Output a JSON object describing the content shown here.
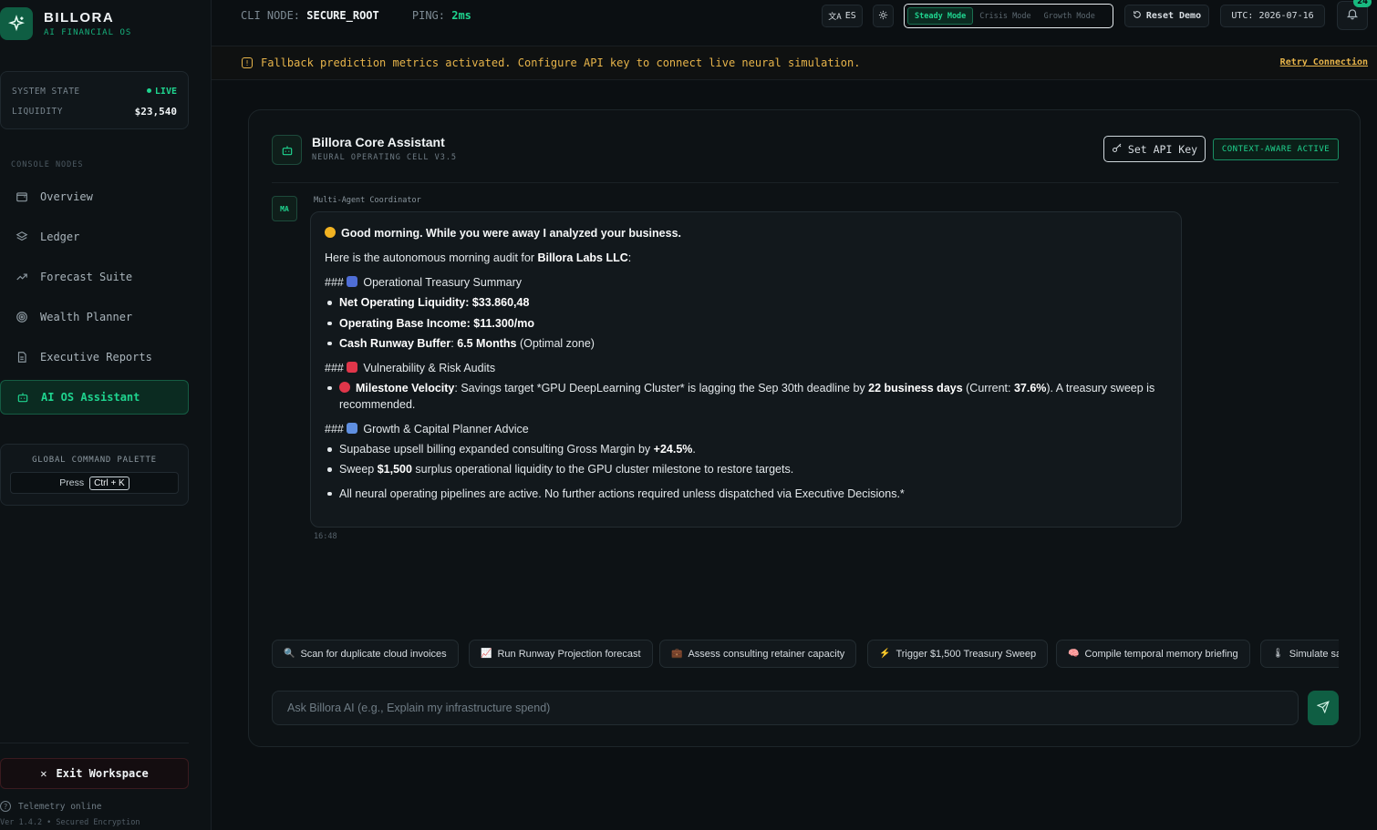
{
  "brand": {
    "name": "BILLORA",
    "subtitle": "AI FINANCIAL OS"
  },
  "system": {
    "state_label": "SYSTEM STATE",
    "state_value": "LIVE",
    "liquidity_label": "LIQUIDITY",
    "liquidity_value": "$23,540"
  },
  "nav": {
    "header": "CONSOLE NODES",
    "items": [
      {
        "label": "Overview",
        "icon": "wallet-icon"
      },
      {
        "label": "Ledger",
        "icon": "layers-icon"
      },
      {
        "label": "Forecast Suite",
        "icon": "trend-up-icon"
      },
      {
        "label": "Wealth Planner",
        "icon": "target-icon"
      },
      {
        "label": "Executive Reports",
        "icon": "document-icon"
      },
      {
        "label": "AI OS Assistant",
        "icon": "bot-icon",
        "active": true
      }
    ]
  },
  "palette": {
    "title": "GLOBAL COMMAND PALETTE",
    "press": "Press",
    "shortcut": "Ctrl + K"
  },
  "exit_label": "Exit Workspace",
  "telemetry": "Telemetry online",
  "version": "Ver 1.4.2 • Secured Encryption",
  "topbar": {
    "cli_label": "CLI NODE:",
    "cli_value": "SECURE_ROOT",
    "ping_label": "PING:",
    "ping_value": "2ms",
    "lang": "ES",
    "modes": [
      "Steady Mode",
      "Crisis Mode",
      "Growth Mode"
    ],
    "active_mode": "Steady Mode",
    "reset_label": "Reset Demo",
    "utc": "UTC: 2026-07-16",
    "notifications": "24"
  },
  "banner": {
    "message": "Fallback prediction metrics activated. Configure API key to connect live neural simulation.",
    "retry": "Retry Connection"
  },
  "assistant": {
    "title": "Billora Core Assistant",
    "subtitle": "NEURAL OPERATING CELL V3.5",
    "api_button": "Set API Key",
    "context_badge": "CONTEXT-AWARE ACTIVE",
    "avatar": "MA",
    "sender": "Multi-Agent Coordinator",
    "timestamp": "16:48"
  },
  "message": {
    "greeting": "Good morning. While you were away I analyzed your business.",
    "intro_a": "Here is the autonomous morning audit for ",
    "intro_company": "Billora Labs LLC",
    "intro_b": ":",
    "h1": "Operational Treasury Summary",
    "h1_bullets": [
      {
        "label": "Net Operating Liquidity",
        "value": "$33.860,48",
        "note": ""
      },
      {
        "label": "Operating Base Income",
        "value": "$11.300/mo",
        "note": ""
      },
      {
        "label": "Cash Runway Buffer",
        "value": "6.5 Months",
        "note": " (Optimal zone)"
      }
    ],
    "h2": "Vulnerability & Risk Audits",
    "h2_bullet": {
      "label": "Milestone Velocity",
      "a": ": Savings target *GPU DeepLearning Cluster* is lagging the Sep 30th deadline by ",
      "days": "22 business days",
      "b": " (Current: ",
      "pct": "37.6%",
      "c": "). A treasury sweep is recommended."
    },
    "h3": "Growth & Capital Planner Advice",
    "h3_bullet_1_a": "Supabase upsell billing expanded consulting Gross Margin by ",
    "h3_bullet_1_b": "+24.5%",
    "h3_bullet_1_c": ".",
    "h3_bullet_2_a": "Sweep ",
    "h3_bullet_2_b": "$1,500",
    "h3_bullet_2_c": " surplus operational liquidity to the GPU cluster milestone to restore targets.",
    "closing": "All neural operating pipelines are active. No further actions required unless dispatched via Executive Decisions.*"
  },
  "chips": [
    {
      "label": "Scan for duplicate cloud invoices",
      "icon": "search-icon"
    },
    {
      "label": "Run Runway Projection forecast",
      "icon": "chart-icon"
    },
    {
      "label": "Assess consulting retainer capacity",
      "icon": "briefcase-icon"
    },
    {
      "label": "Trigger $1,500 Treasury Sweep",
      "icon": "bolt-icon"
    },
    {
      "label": "Compile temporal memory briefing",
      "icon": "brain-icon"
    },
    {
      "label": "Simulate sa",
      "icon": "thermometer-icon"
    }
  ],
  "input": {
    "placeholder": "Ask Billora AI (e.g., Explain my infrastructure spend)"
  },
  "colors": {
    "accent": "#1fd48f",
    "warning": "#e7b44a",
    "background": "#0b0f12"
  }
}
